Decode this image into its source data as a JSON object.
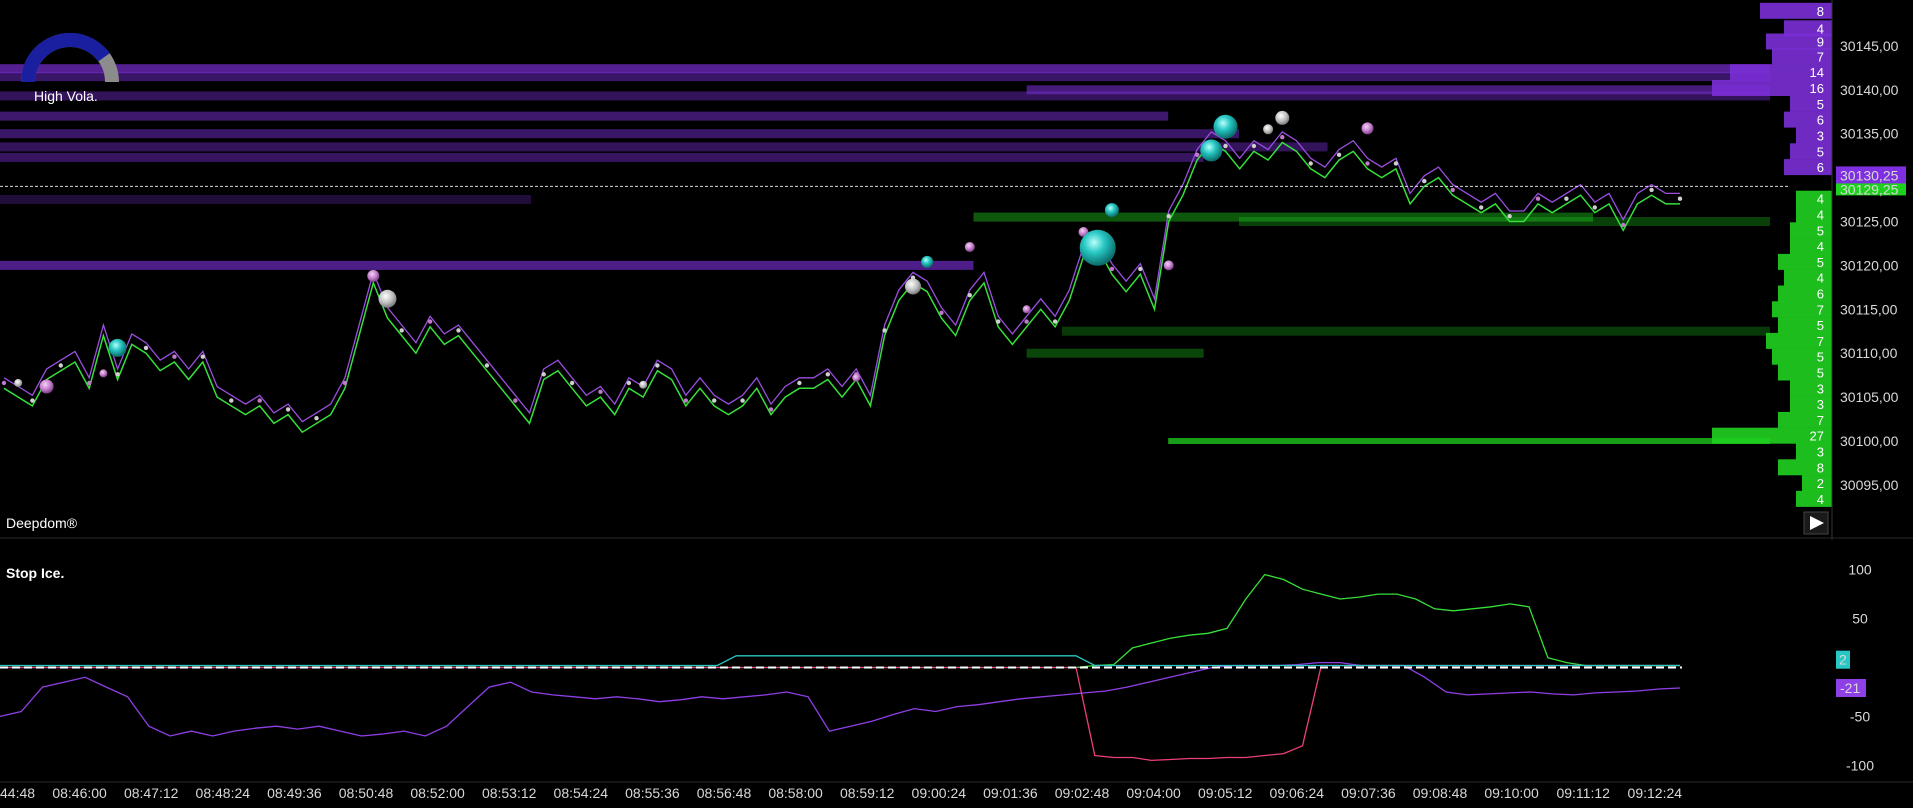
{
  "gauge": {
    "label": "High Vola.",
    "level": 0.8
  },
  "main_panel": {
    "title": "Deepdom®",
    "play_icon": "play-icon"
  },
  "stop_panel": {
    "title": "Stop Ice."
  },
  "colors": {
    "price_line": "#36e03a",
    "price_line_upper": "#9b4fe0",
    "heat_purple": "#7a2fd6",
    "heat_green": "#1fd11f",
    "cyan": "#27c7c3",
    "pink": "#ec3f7e",
    "white_bubble": "#c8c8c8",
    "pink_bubble": "#c07ac8",
    "current_price_bg": "#7e2fe0",
    "axis_text": "#d8d8d8"
  },
  "chart_data": [
    {
      "type": "line",
      "name": "price",
      "yticks": [
        "30145,00",
        "30140,00",
        "30135,00",
        "30130,00",
        "30125,00",
        "30120,00",
        "30115,00",
        "30110,00",
        "30105,00",
        "30100,00",
        "30095,00"
      ],
      "ylim": [
        30091,
        30150
      ],
      "current_price_label": "30130,25",
      "secondary_price_label": "30129,25",
      "x_labels": [
        "44:48",
        "08:46:00",
        "08:47:12",
        "08:48:24",
        "08:49:36",
        "08:50:48",
        "08:52:00",
        "08:53:12",
        "08:54:24",
        "08:55:36",
        "08:56:48",
        "08:58:00",
        "08:59:12",
        "09:00:24",
        "09:01:36",
        "09:02:48",
        "09:04:00",
        "09:05:12",
        "09:06:24",
        "09:07:36",
        "09:08:48",
        "09:10:00",
        "09:11:12",
        "09:12:24"
      ],
      "values": [
        30106,
        30105,
        30104,
        30107,
        30108,
        30109,
        30106,
        30112,
        30107,
        30111,
        30110,
        30108,
        30109,
        30107,
        30109,
        30105,
        30104,
        30103,
        30104,
        30102,
        30103,
        30101,
        30102,
        30103,
        30106,
        30112,
        30118,
        30114,
        30112,
        30110,
        30113,
        30111,
        30112,
        30110,
        30108,
        30106,
        30104,
        30102,
        30107,
        30108,
        30106,
        30104,
        30105,
        30103,
        30106,
        30105,
        30108,
        30107,
        30104,
        30106,
        30104,
        30103,
        30104,
        30106,
        30103,
        30105,
        30106,
        30106,
        30107,
        30105,
        30107,
        30104,
        30112,
        30116,
        30118,
        30117,
        30114,
        30112,
        30116,
        30118,
        30113,
        30111,
        30113,
        30115,
        30113,
        30116,
        30121,
        30122,
        30119,
        30117,
        30119,
        30115,
        30125,
        30128,
        30132,
        30134,
        30133,
        30131,
        30133,
        30132,
        30134,
        30133,
        30131,
        30130,
        30132,
        30133,
        30131,
        30130,
        30131,
        30127,
        30129,
        30130,
        30128,
        30127,
        30126,
        30127,
        30125,
        30125,
        30127,
        30126,
        30127,
        30128,
        30126,
        30127,
        30124,
        30127,
        30128,
        30127,
        30127
      ],
      "upper_offset": 1.2,
      "bubbles": [
        {
          "i": 1,
          "v": 30106.6,
          "r": 4,
          "c": "white"
        },
        {
          "i": 3,
          "v": 30106.2,
          "r": 7,
          "c": "pink"
        },
        {
          "i": 8,
          "v": 30110.6,
          "r": 9,
          "c": "cyan"
        },
        {
          "i": 7,
          "v": 30107.7,
          "r": 4,
          "c": "pink"
        },
        {
          "i": 26,
          "v": 30118.8,
          "r": 6,
          "c": "pink"
        },
        {
          "i": 27,
          "v": 30116.2,
          "r": 9,
          "c": "white"
        },
        {
          "i": 45,
          "v": 30106.4,
          "r": 4,
          "c": "white"
        },
        {
          "i": 60,
          "v": 30107.2,
          "r": 4,
          "c": "pink"
        },
        {
          "i": 64,
          "v": 30117.6,
          "r": 8,
          "c": "white"
        },
        {
          "i": 65,
          "v": 30120.4,
          "r": 6,
          "c": "cyan"
        },
        {
          "i": 68,
          "v": 30122.1,
          "r": 5,
          "c": "pink"
        },
        {
          "i": 72,
          "v": 30115,
          "r": 4,
          "c": "pink"
        },
        {
          "i": 76,
          "v": 30123.8,
          "r": 5,
          "c": "pink"
        },
        {
          "i": 77,
          "v": 30122,
          "r": 18,
          "c": "cyan"
        },
        {
          "i": 78,
          "v": 30126.3,
          "r": 7,
          "c": "cyan"
        },
        {
          "i": 82,
          "v": 30120,
          "r": 5,
          "c": "pink"
        },
        {
          "i": 85,
          "v": 30133.1,
          "r": 11,
          "c": "cyan"
        },
        {
          "i": 86,
          "v": 30135.8,
          "r": 12,
          "c": "cyan"
        },
        {
          "i": 89,
          "v": 30135.5,
          "r": 5,
          "c": "white"
        },
        {
          "i": 90,
          "v": 30136.8,
          "r": 7,
          "c": "white"
        },
        {
          "i": 96,
          "v": 30135.6,
          "r": 6,
          "c": "pink"
        }
      ],
      "heatmap_rows": [
        {
          "price": 30142.4,
          "x0": 0.0,
          "x1": 1.0,
          "intensity": 0.9,
          "color": "purple"
        },
        {
          "price": 30141.5,
          "x0": 0.0,
          "x1": 1.0,
          "intensity": 0.55,
          "color": "purple"
        },
        {
          "price": 30140.0,
          "x0": 0.58,
          "x1": 1.0,
          "intensity": 0.7,
          "color": "purple"
        },
        {
          "price": 30139.3,
          "x0": 0.0,
          "x1": 1.0,
          "intensity": 0.45,
          "color": "purple"
        },
        {
          "price": 30137.0,
          "x0": 0.0,
          "x1": 0.66,
          "intensity": 0.6,
          "color": "purple"
        },
        {
          "price": 30135.0,
          "x0": 0.0,
          "x1": 0.7,
          "intensity": 0.55,
          "color": "purple"
        },
        {
          "price": 30133.5,
          "x0": 0.0,
          "x1": 0.75,
          "intensity": 0.45,
          "color": "purple"
        },
        {
          "price": 30132.3,
          "x0": 0.0,
          "x1": 0.68,
          "intensity": 0.5,
          "color": "purple"
        },
        {
          "price": 30120.0,
          "x0": 0.0,
          "x1": 0.55,
          "intensity": 0.8,
          "color": "purple"
        },
        {
          "price": 30127.5,
          "x0": 0.0,
          "x1": 0.3,
          "intensity": 0.2,
          "color": "purple"
        },
        {
          "price": 30125.5,
          "x0": 0.55,
          "x1": 0.9,
          "intensity": 0.45,
          "color": "green"
        },
        {
          "price": 30125.0,
          "x0": 0.7,
          "x1": 1.0,
          "intensity": 0.25,
          "color": "green"
        },
        {
          "price": 30112.5,
          "x0": 0.6,
          "x1": 1.0,
          "intensity": 0.2,
          "color": "green"
        },
        {
          "price": 30110.0,
          "x0": 0.58,
          "x1": 0.68,
          "intensity": 0.3,
          "color": "green"
        },
        {
          "price": 30100.0,
          "x0": 0.66,
          "x1": 1.0,
          "intensity": 1.0,
          "color": "green"
        }
      ],
      "volume_profile": [
        {
          "price": 30149,
          "label": "8",
          "size": 0.6,
          "color": "purple"
        },
        {
          "price": 30147,
          "label": "4",
          "size": 0.4,
          "color": "purple"
        },
        {
          "price": 30145.5,
          "label": "9",
          "size": 0.55,
          "color": "purple"
        },
        {
          "price": 30143.8,
          "label": "7",
          "size": 0.5,
          "color": "purple"
        },
        {
          "price": 30142,
          "label": "14",
          "size": 0.85,
          "color": "purple"
        },
        {
          "price": 30140.2,
          "label": "16",
          "size": 1.0,
          "color": "purple"
        },
        {
          "price": 30138.4,
          "label": "5",
          "size": 0.35,
          "color": "purple"
        },
        {
          "price": 30136.6,
          "label": "6",
          "size": 0.4,
          "color": "purple"
        },
        {
          "price": 30134.8,
          "label": "3",
          "size": 0.3,
          "color": "purple"
        },
        {
          "price": 30133,
          "label": "5",
          "size": 0.35,
          "color": "purple"
        },
        {
          "price": 30131.2,
          "label": "6",
          "size": 0.4,
          "color": "purple"
        },
        {
          "price": 30127.6,
          "label": "4",
          "size": 0.3,
          "color": "green"
        },
        {
          "price": 30125.8,
          "label": "4",
          "size": 0.3,
          "color": "green"
        },
        {
          "price": 30124,
          "label": "5",
          "size": 0.35,
          "color": "green"
        },
        {
          "price": 30122.2,
          "label": "4",
          "size": 0.35,
          "color": "green"
        },
        {
          "price": 30120.4,
          "label": "5",
          "size": 0.45,
          "color": "green"
        },
        {
          "price": 30118.6,
          "label": "4",
          "size": 0.4,
          "color": "green"
        },
        {
          "price": 30116.8,
          "label": "6",
          "size": 0.45,
          "color": "green"
        },
        {
          "price": 30115,
          "label": "7",
          "size": 0.5,
          "color": "green"
        },
        {
          "price": 30113.2,
          "label": "5",
          "size": 0.45,
          "color": "green"
        },
        {
          "price": 30111.4,
          "label": "7",
          "size": 0.55,
          "color": "green"
        },
        {
          "price": 30109.6,
          "label": "5",
          "size": 0.5,
          "color": "green"
        },
        {
          "price": 30107.8,
          "label": "5",
          "size": 0.45,
          "color": "green"
        },
        {
          "price": 30106,
          "label": "3",
          "size": 0.35,
          "color": "green"
        },
        {
          "price": 30104.2,
          "label": "3",
          "size": 0.35,
          "color": "green"
        },
        {
          "price": 30102.4,
          "label": "7",
          "size": 0.45,
          "color": "green"
        },
        {
          "price": 30100.6,
          "label": "27",
          "size": 1.0,
          "color": "green"
        },
        {
          "price": 30098.8,
          "label": "3",
          "size": 0.3,
          "color": "green"
        },
        {
          "price": 30097,
          "label": "8",
          "size": 0.45,
          "color": "green"
        },
        {
          "price": 30095.2,
          "label": "2",
          "size": 0.25,
          "color": "green"
        },
        {
          "price": 30093.4,
          "label": "4",
          "size": 0.3,
          "color": "green"
        }
      ]
    },
    {
      "type": "line",
      "name": "stop-ice",
      "yticks": [
        "100",
        "50",
        "-50",
        "-100"
      ],
      "ylim": [
        -115,
        115
      ],
      "value_labels": [
        "2",
        "-21"
      ],
      "series": [
        {
          "color": "purple",
          "values": [
            -50,
            -45,
            -20,
            -15,
            -10,
            -20,
            -30,
            -60,
            -70,
            -65,
            -70,
            -65,
            -62,
            -60,
            -63,
            -60,
            -65,
            -70,
            -68,
            -65,
            -70,
            -60,
            -40,
            -20,
            -15,
            -25,
            -28,
            -30,
            -32,
            -30,
            -32,
            -35,
            -33,
            -30,
            -32,
            -30,
            -28,
            -25,
            -30,
            -65,
            -60,
            -55,
            -48,
            -42,
            -45,
            -40,
            -38,
            -35,
            -32,
            -30,
            -28,
            -26,
            -24,
            -20,
            -15,
            -10,
            -5,
            0,
            2,
            2,
            2,
            3,
            5,
            5,
            2,
            2,
            2,
            -10,
            -25,
            -28,
            -27,
            -26,
            -25,
            -27,
            -28,
            -26,
            -25,
            -24,
            -22,
            -21
          ]
        },
        {
          "color": "green",
          "values": [
            0,
            0,
            0,
            0,
            0,
            0,
            0,
            0,
            0,
            0,
            0,
            0,
            0,
            0,
            0,
            0,
            0,
            0,
            0,
            0,
            0,
            0,
            0,
            0,
            0,
            0,
            0,
            0,
            0,
            0,
            0,
            0,
            0,
            0,
            0,
            0,
            0,
            0,
            0,
            0,
            0,
            0,
            0,
            0,
            0,
            0,
            0,
            0,
            0,
            0,
            0,
            0,
            0,
            0,
            0,
            0,
            0,
            0,
            2,
            3,
            20,
            25,
            30,
            33,
            35,
            40,
            70,
            95,
            90,
            80,
            75,
            70,
            72,
            75,
            75,
            70,
            60,
            58,
            60,
            62,
            65,
            62,
            10,
            5,
            2,
            2,
            2,
            2,
            2,
            2
          ]
        },
        {
          "color": "pink",
          "values": [
            0,
            0,
            0,
            0,
            0,
            0,
            0,
            0,
            0,
            0,
            0,
            0,
            0,
            0,
            0,
            0,
            0,
            0,
            0,
            0,
            0,
            0,
            0,
            0,
            0,
            0,
            0,
            0,
            0,
            0,
            0,
            0,
            0,
            0,
            0,
            0,
            0,
            0,
            0,
            0,
            0,
            0,
            0,
            0,
            0,
            0,
            0,
            0,
            0,
            0,
            0,
            0,
            0,
            0,
            0,
            0,
            0,
            0,
            -90,
            -92,
            -92,
            -95,
            -94,
            -93,
            -93,
            -92,
            -92,
            -90,
            -88,
            -80,
            2,
            2,
            2,
            2,
            2,
            2,
            2,
            2,
            2,
            2,
            2,
            2,
            2,
            2,
            2,
            2,
            2,
            2,
            2,
            2
          ]
        },
        {
          "color": "cyan",
          "values": [
            2,
            2,
            2,
            2,
            2,
            2,
            2,
            2,
            2,
            2,
            2,
            2,
            2,
            2,
            2,
            2,
            2,
            2,
            2,
            2,
            2,
            2,
            2,
            2,
            2,
            2,
            2,
            2,
            2,
            2,
            2,
            2,
            2,
            2,
            2,
            2,
            2,
            2,
            2,
            12,
            12,
            12,
            12,
            12,
            12,
            12,
            12,
            12,
            12,
            12,
            12,
            12,
            12,
            12,
            12,
            12,
            12,
            12,
            2,
            2,
            2,
            2,
            2,
            2,
            2,
            2,
            2,
            2,
            2,
            2,
            2,
            2,
            2,
            2,
            2,
            2,
            2,
            2,
            2,
            2,
            2,
            2,
            2,
            2,
            2,
            2,
            2,
            2,
            2,
            2
          ]
        }
      ]
    }
  ]
}
